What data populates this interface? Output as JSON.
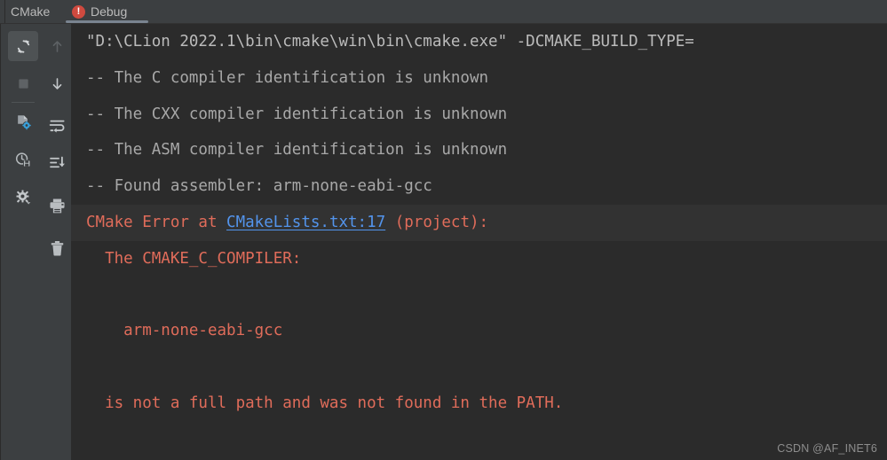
{
  "window": {
    "tool_label": "CMake",
    "background_color": "#2b2b2b",
    "panel_color": "#3c3f41"
  },
  "tabbar": {
    "tabs": [
      {
        "label": "Debug",
        "badge_icon": "error-circle-icon",
        "badge_glyph": "!",
        "badge_color": "#cf4a3f",
        "selected": true
      }
    ]
  },
  "sidebar": {
    "left_column": [
      {
        "name": "rerun-cmake-button",
        "icon": "refresh-icon",
        "active": true,
        "enabled": true
      },
      {
        "name": "stop-button",
        "icon": "stop-square-icon",
        "active": false,
        "enabled": false
      },
      {
        "name": "cmake-settings-button",
        "icon": "file-gear-icon",
        "active": false,
        "enabled": true
      },
      {
        "name": "reset-cache-reload-button",
        "icon": "clock-save-icon",
        "active": false,
        "enabled": true
      },
      {
        "name": "console-settings-button",
        "icon": "gear-dropdown-icon",
        "active": false,
        "enabled": true
      }
    ],
    "right_column": [
      {
        "name": "previous-occurrence-button",
        "icon": "arrow-up-icon",
        "enabled": false
      },
      {
        "name": "next-occurrence-button",
        "icon": "arrow-down-icon",
        "enabled": true
      },
      {
        "name": "soft-wrap-button",
        "icon": "soft-wrap-icon",
        "enabled": true
      },
      {
        "name": "scroll-to-end-button",
        "icon": "scroll-to-end-icon",
        "enabled": true
      },
      {
        "name": "print-button",
        "icon": "printer-icon",
        "enabled": true
      },
      {
        "name": "clear-all-button",
        "icon": "trash-icon",
        "enabled": true
      }
    ]
  },
  "console": {
    "lines": [
      {
        "id": "line-command",
        "style": "cmd",
        "highlight": false,
        "text": "\"D:\\CLion 2022.1\\bin\\cmake\\win\\bin\\cmake.exe\" -DCMAKE_BUILD_TYPE="
      },
      {
        "id": "line-c-compiler",
        "style": "info",
        "highlight": false,
        "text": "-- The C compiler identification is unknown"
      },
      {
        "id": "line-cxx-compiler",
        "style": "info",
        "highlight": false,
        "text": "-- The CXX compiler identification is unknown"
      },
      {
        "id": "line-asm-compiler",
        "style": "info",
        "highlight": false,
        "text": "-- The ASM compiler identification is unknown"
      },
      {
        "id": "line-found-assembler",
        "style": "info",
        "highlight": false,
        "text": "-- Found assembler: arm-none-eabi-gcc"
      },
      {
        "id": "line-error-header",
        "style": "err",
        "highlight": true,
        "segments": [
          {
            "text": "CMake Error at ",
            "link": false
          },
          {
            "text": "CMakeLists.txt:17",
            "link": true
          },
          {
            "text": " (project):",
            "link": false
          }
        ]
      },
      {
        "id": "line-error-compiler-var",
        "style": "err",
        "highlight": false,
        "text": "  The CMAKE_C_COMPILER:"
      },
      {
        "id": "line-error-blank-1",
        "style": "err",
        "highlight": false,
        "text": ""
      },
      {
        "id": "line-error-compiler-value",
        "style": "err",
        "highlight": false,
        "text": "    arm-none-eabi-gcc"
      },
      {
        "id": "line-error-blank-2",
        "style": "err",
        "highlight": false,
        "text": ""
      },
      {
        "id": "line-error-detail",
        "style": "err",
        "highlight": false,
        "text": "  is not a full path and was not found in the PATH."
      }
    ],
    "colors": {
      "command_text": "#bbbbbb",
      "info_text": "#a8a8a8",
      "error_text": "#e06c5a",
      "link_text": "#5394ec",
      "highlight_row": "#323232"
    }
  },
  "watermark": {
    "text": "CSDN @AF_INET6"
  }
}
